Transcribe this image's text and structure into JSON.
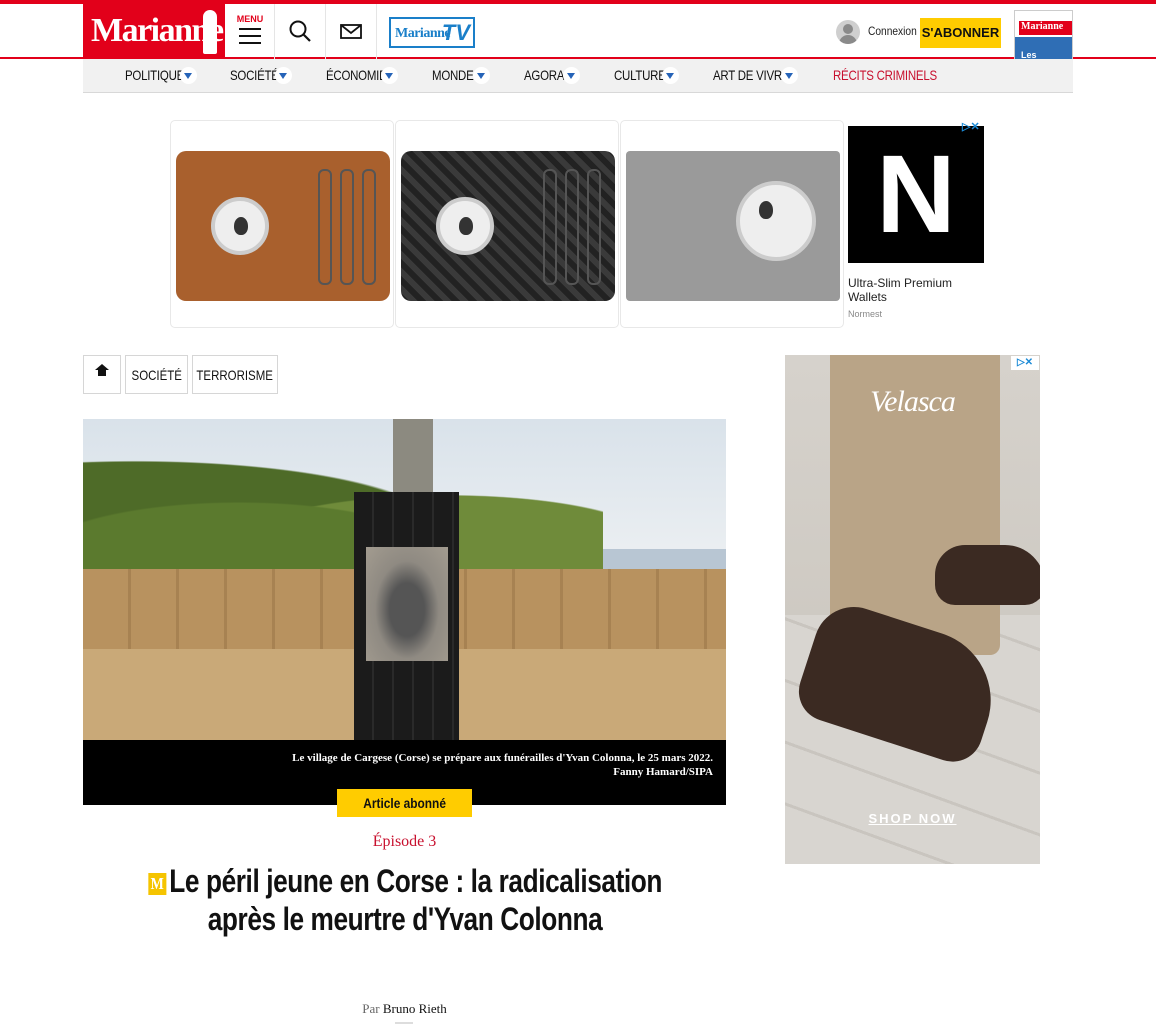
{
  "header": {
    "logo": "Marianne",
    "menu_label": "MENU",
    "tv_logo_main": "Marianne",
    "tv_logo_suffix": "TV",
    "login": "Connexion",
    "subscribe": "S'ABONNER",
    "magazine_logo": "Marianne",
    "magazine_cover_text": "Les conquêtes silencieuses du RN"
  },
  "nav": {
    "items": [
      {
        "label": "POLITIQUE"
      },
      {
        "label": "SOCIÉTÉ"
      },
      {
        "label": "ÉCONOMIE"
      },
      {
        "label": "MONDE"
      },
      {
        "label": "AGORA"
      },
      {
        "label": "CULTURE"
      },
      {
        "label": "ART DE VIVRE"
      },
      {
        "label": "RÉCITS CRIMINELS"
      }
    ],
    "highlight_color": "#c8102e"
  },
  "top_ad": {
    "logo_letter": "N",
    "text": "Ultra-Slim Premium Wallets",
    "brand": "Normest",
    "choice": "▷✕"
  },
  "breadcrumb": {
    "items": [
      {
        "label": "SOCIÉTÉ"
      },
      {
        "label": "TERRORISME"
      }
    ]
  },
  "hero": {
    "caption": "Le village de Cargese (Corse) se prépare aux funérailles d'Yvan Colonna, le 25 mars 2022.",
    "credit": "Fanny Hamard/SIPA"
  },
  "article": {
    "badge": "Article abonné",
    "episode": "Épisode 3",
    "premium_marker": "M",
    "title": "Le péril jeune en Corse : la radicalisation après le meurtre d'Yvan Colonna",
    "byline_prefix": "Par",
    "author": "Bruno Rieth"
  },
  "side_ad": {
    "brand": "Velasca",
    "cta": "SHOP NOW",
    "choice": "▷✕"
  },
  "colors": {
    "brand_red": "#e2001a",
    "subscribe_yellow": "#ffcc00",
    "tv_blue": "#1a7fc9"
  }
}
